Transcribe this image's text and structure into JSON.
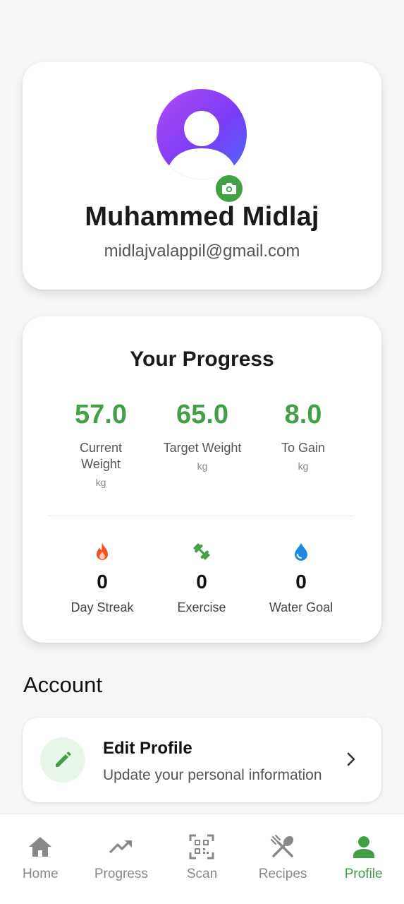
{
  "profile": {
    "name": "Muhammed Midlaj",
    "email": "midlajvalappil@gmail.com"
  },
  "progress": {
    "title": "Your Progress",
    "metrics": [
      {
        "value": "57.0",
        "label": "Current Weight",
        "unit": "kg"
      },
      {
        "value": "65.0",
        "label": "Target Weight",
        "unit": "kg"
      },
      {
        "value": "8.0",
        "label": "To Gain",
        "unit": "kg"
      }
    ],
    "stats": [
      {
        "icon": "fire-icon",
        "value": "0",
        "label": "Day Streak"
      },
      {
        "icon": "dumbbell-icon",
        "value": "0",
        "label": "Exercise"
      },
      {
        "icon": "water-drop-icon",
        "value": "0",
        "label": "Water Goal"
      }
    ]
  },
  "account": {
    "section_title": "Account",
    "edit_profile": {
      "title": "Edit Profile",
      "subtitle": "Update your personal information"
    }
  },
  "nav": {
    "items": [
      {
        "label": "Home",
        "icon": "home-icon"
      },
      {
        "label": "Progress",
        "icon": "trending-up-icon"
      },
      {
        "label": "Scan",
        "icon": "qr-scan-icon"
      },
      {
        "label": "Recipes",
        "icon": "utensils-icon"
      },
      {
        "label": "Profile",
        "icon": "person-icon"
      }
    ],
    "active": "Profile"
  },
  "colors": {
    "accent": "#43a047",
    "accent_light": "#e8f5e9",
    "fire": "#f4511e",
    "water": "#1e88e5",
    "avatar_gradient_start": "#b24bf3",
    "avatar_gradient_end": "#4a6af8"
  }
}
